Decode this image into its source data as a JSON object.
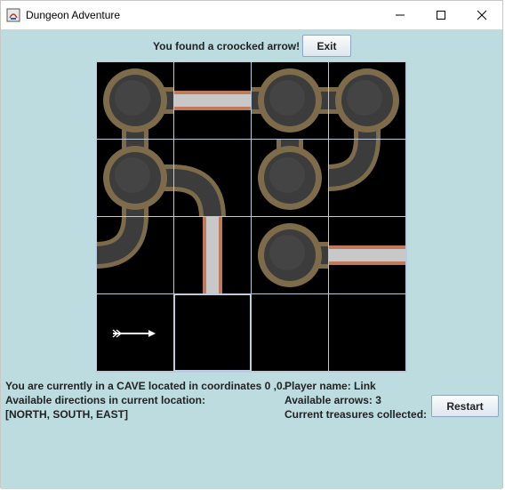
{
  "window": {
    "title": "Dungeon Adventure",
    "controls": [
      "minimize",
      "maximize",
      "close"
    ]
  },
  "header": {
    "message": "You found a croocked arrow!",
    "exit_label": "Exit"
  },
  "board": {
    "rows": 4,
    "cols": 4,
    "cells": [
      {
        "row": 0,
        "col": 0,
        "room": "cave",
        "paths": [
          "east"
        ],
        "exits_edge": [
          "south"
        ]
      },
      {
        "row": 0,
        "col": 1,
        "room": "tunnel",
        "paths": [
          "west",
          "east"
        ]
      },
      {
        "row": 0,
        "col": 2,
        "room": "cave",
        "paths": [
          "west",
          "east"
        ]
      },
      {
        "row": 0,
        "col": 3,
        "room": "cave",
        "paths": [
          "west",
          "south"
        ]
      },
      {
        "row": 1,
        "col": 0,
        "room": "cave",
        "paths": [
          "north",
          "east",
          "south"
        ]
      },
      {
        "row": 1,
        "col": 1,
        "room": "tunnel",
        "paths": [
          "west",
          "south"
        ]
      },
      {
        "row": 1,
        "col": 2,
        "room": "cave",
        "paths": [
          "north"
        ]
      },
      {
        "row": 1,
        "col": 3,
        "room": "tunnel",
        "paths": [
          "north",
          "west"
        ]
      },
      {
        "row": 2,
        "col": 0,
        "room": "tunnel",
        "paths": [
          "north",
          "west"
        ]
      },
      {
        "row": 2,
        "col": 1,
        "room": "tunnel",
        "paths": [
          "north"
        ]
      },
      {
        "row": 2,
        "col": 2,
        "room": "cave",
        "paths": [
          "east"
        ]
      },
      {
        "row": 2,
        "col": 3,
        "room": "tunnel",
        "paths": [
          "west",
          "east"
        ]
      },
      {
        "row": 3,
        "col": 0,
        "room": "unexplored",
        "item": "arrow-icon"
      },
      {
        "row": 3,
        "col": 1,
        "room": "unexplored",
        "highlight": true
      },
      {
        "row": 3,
        "col": 2,
        "room": "unexplored"
      },
      {
        "row": 3,
        "col": 3,
        "room": "unexplored"
      }
    ]
  },
  "status": {
    "location_text": "You are currently in a CAVE located in coordinates 0 ,0.",
    "directions_label": "Available directions in current location:",
    "directions_value": "[NORTH, SOUTH, EAST]",
    "player_label": "Player name: Link",
    "arrows_label": "Available arrows: 3",
    "treasures_label": "Current treasures collected:"
  },
  "actions": {
    "restart_label": "Restart"
  },
  "colors": {
    "background": "#bcdce0",
    "button_border": "#8da7c0",
    "tunnel_brick": "#7d6b4a",
    "tunnel_floor": "#3c3c3c",
    "bridge": "#c8c8c8",
    "bridge_edge": "#c07a5a"
  }
}
